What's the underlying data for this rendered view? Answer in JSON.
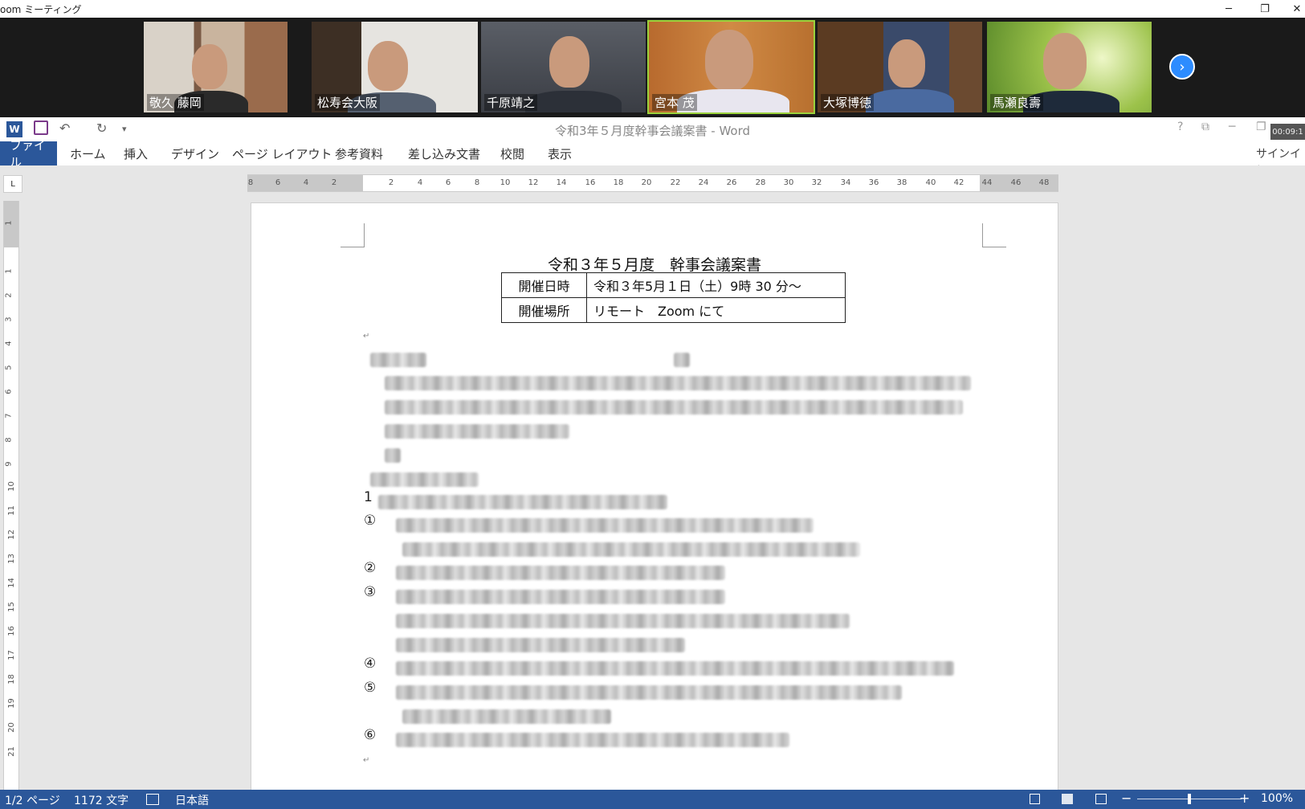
{
  "zoom": {
    "window_title": "oom ミーティング",
    "window_controls": {
      "minimize": "─",
      "restore": "❐",
      "close": "✕"
    },
    "next_page_icon": "chevron-right-icon",
    "participants": [
      {
        "name": "敬久 藤岡",
        "active": false
      },
      {
        "name": "松寿会大阪",
        "active": false
      },
      {
        "name": "千原靖之",
        "active": false
      },
      {
        "name": "宮本  茂",
        "active": true
      },
      {
        "name": "大塚博徳",
        "active": false
      },
      {
        "name": "馬瀬良壽",
        "active": false
      }
    ]
  },
  "word": {
    "app_icon_letter": "W",
    "quick_access": {
      "save_icon": "save-icon",
      "undo_glyph": "↶",
      "redo_glyph": "↻",
      "customize_glyph": "▾"
    },
    "title": "令和3年５月度幹事会議案書 - Word",
    "title_controls": {
      "help": "?",
      "ribbon_display": "⧉",
      "minimize": "─",
      "restore": "❐"
    },
    "timer": "00:09:1",
    "ribbon_tabs": [
      "ファイル",
      "ホーム",
      "挿入",
      "デザイン",
      "ページ レイアウト",
      "参考資料",
      "差し込み文書",
      "校閲",
      "表示"
    ],
    "signin": "サインイン",
    "ruler_corner": "L",
    "h_ruler_ticks": [
      "8",
      "6",
      "4",
      "2",
      "2",
      "4",
      "6",
      "8",
      "10",
      "12",
      "14",
      "16",
      "18",
      "20",
      "22",
      "24",
      "26",
      "28",
      "30",
      "32",
      "34",
      "36",
      "38",
      "40",
      "42",
      "44",
      "46",
      "48"
    ],
    "v_ruler_ticks": [
      "1",
      "1",
      "2",
      "3",
      "4",
      "5",
      "6",
      "7",
      "8",
      "9",
      "10",
      "11",
      "12",
      "13",
      "14",
      "15",
      "16",
      "17",
      "18",
      "19",
      "20",
      "21"
    ]
  },
  "document": {
    "heading": "令和３年５月度　幹事会議案書",
    "meta": [
      {
        "label": "開催日時",
        "value": "令和３年5月１日（土）9時 30 分～"
      },
      {
        "label": "開催場所",
        "value": "リモート　Zoom にて"
      }
    ],
    "paragraph_mark": "↵",
    "list_number": "1",
    "circled_markers": [
      "①",
      "②",
      "③",
      "④",
      "⑤",
      "⑥"
    ]
  },
  "status_bar": {
    "page": "1/2 ページ",
    "word_count": "1172 文字",
    "proofing_icon": "proofing-icon",
    "language": "日本語",
    "zoom_minus": "−",
    "zoom_plus": "+",
    "zoom_level": "100%",
    "zoom_fraction": 0.5
  }
}
